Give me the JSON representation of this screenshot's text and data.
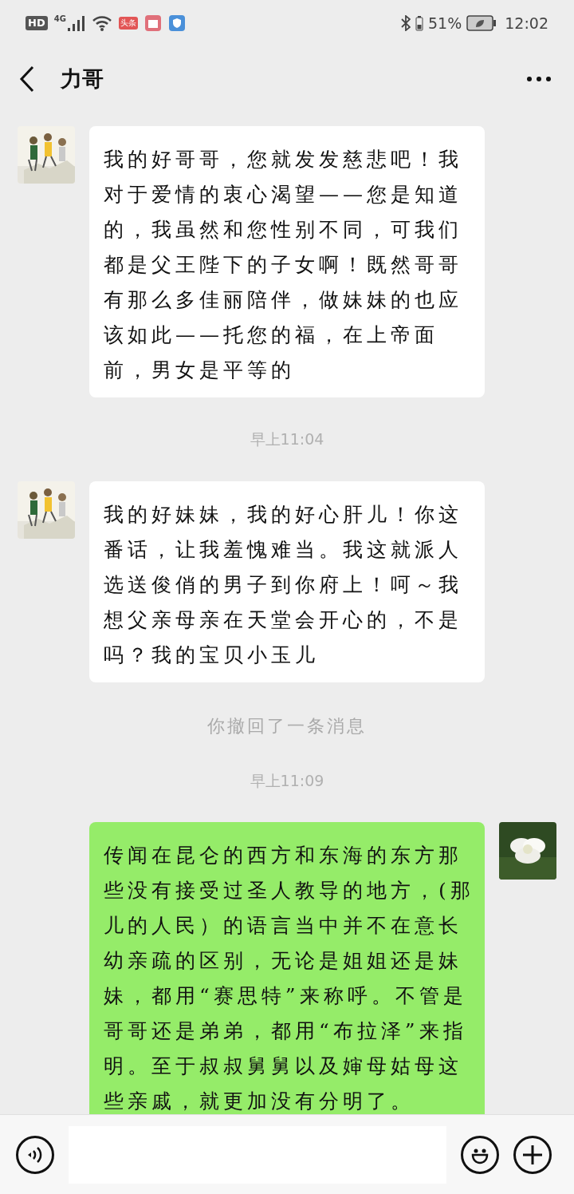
{
  "status_bar": {
    "hd": "HD",
    "network": "4G",
    "app_badge": "头条",
    "battery": "51%",
    "time": "12:02"
  },
  "header": {
    "title": "力哥"
  },
  "messages": [
    {
      "kind": "received",
      "text": "我的好哥哥，您就发发慈悲吧！我对于爱情的衷心渴望——您是知道的，我虽然和您性别不同，可我们都是父王陛下的子女啊！既然哥哥有那么多佳丽陪伴，做妹妹的也应该如此——托您的福，在上帝面前，男女是平等的"
    },
    {
      "kind": "time",
      "text": "早上11:04"
    },
    {
      "kind": "received",
      "text": "我的好妹妹，我的好心肝儿！你这番话，让我羞愧难当。我这就派人选送俊俏的男子到你府上！呵～我想父亲母亲在天堂会开心的，不是吗？我的宝贝小玉儿"
    },
    {
      "kind": "system",
      "text": "你撤回了一条消息"
    },
    {
      "kind": "time",
      "text": "早上11:09"
    },
    {
      "kind": "sent",
      "text": "传闻在昆仑的西方和东海的东方那些没有接受过圣人教导的地方，(那儿的人民）的语言当中并不在意长幼亲疏的区别，无论是姐姐还是妹妹，都用“赛思特”来称呼。不管是哥哥还是弟弟，都用“布拉泽”来指明。至于叔叔舅舅以及婶母姑母这些亲戚，就更加没有分明了。"
    }
  ]
}
